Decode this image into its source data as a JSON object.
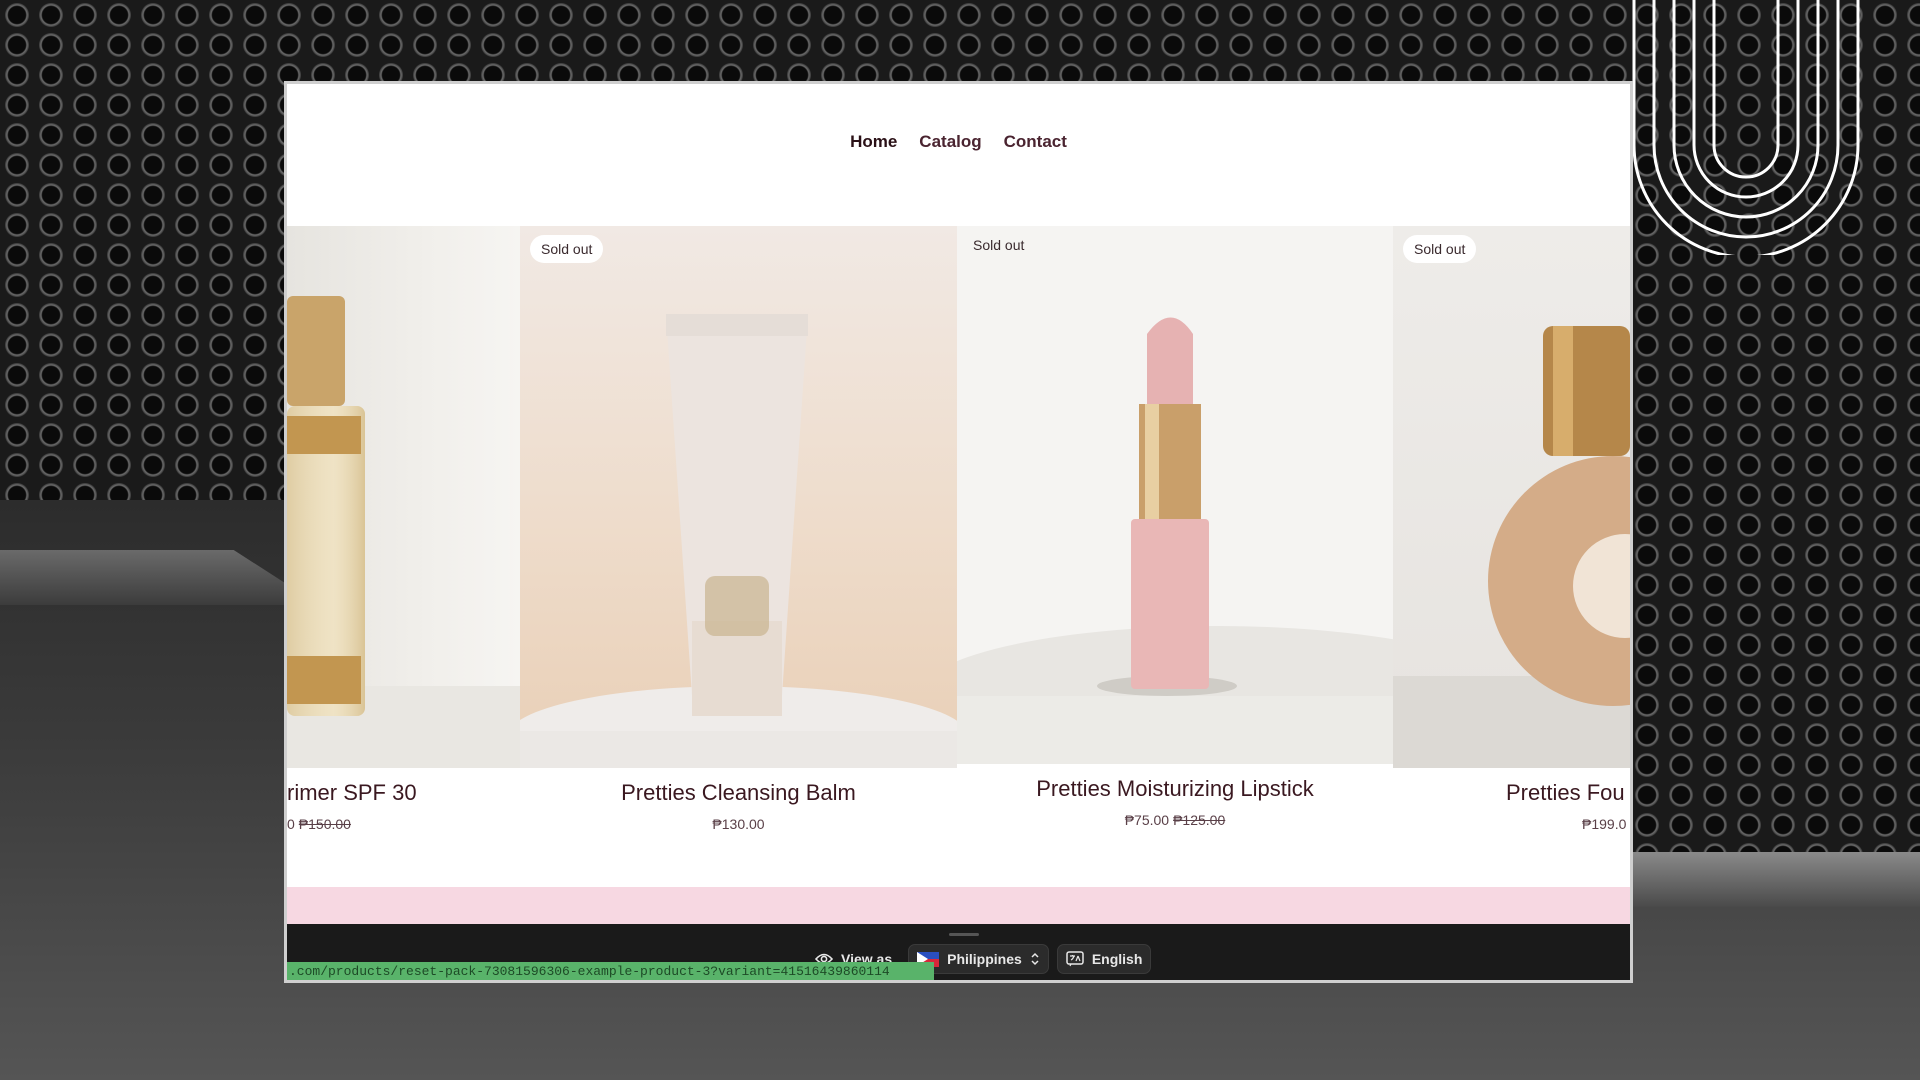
{
  "nav": {
    "items": [
      {
        "label": "Home",
        "active": true
      },
      {
        "label": "Catalog",
        "active": false
      },
      {
        "label": "Contact",
        "active": false
      }
    ]
  },
  "products": [
    {
      "title": "rimer SPF 30",
      "price": "0",
      "compare_price": "₱150.00",
      "badge": ""
    },
    {
      "title": "Pretties Cleansing Balm",
      "price": "₱130.00",
      "compare_price": "",
      "badge": "Sold out"
    },
    {
      "title": "Pretties Moisturizing Lipstick",
      "price": "₱75.00",
      "compare_price": "₱125.00",
      "badge": "Sold out"
    },
    {
      "title": "Pretties Fou",
      "price": "₱199.0",
      "compare_price": "",
      "badge": "Sold out"
    }
  ],
  "toolbar": {
    "view_as": "View as",
    "country": "Philippines",
    "language": "English"
  },
  "status_url": ".com/products/reset-pack-73081596306-example-product-3?variant=41516439860114",
  "colors": {
    "nav_text": "#4a2430",
    "pink_band": "#f7d8e2",
    "dark_bar": "#1a1a1a",
    "url_bar": "#59b36a"
  }
}
